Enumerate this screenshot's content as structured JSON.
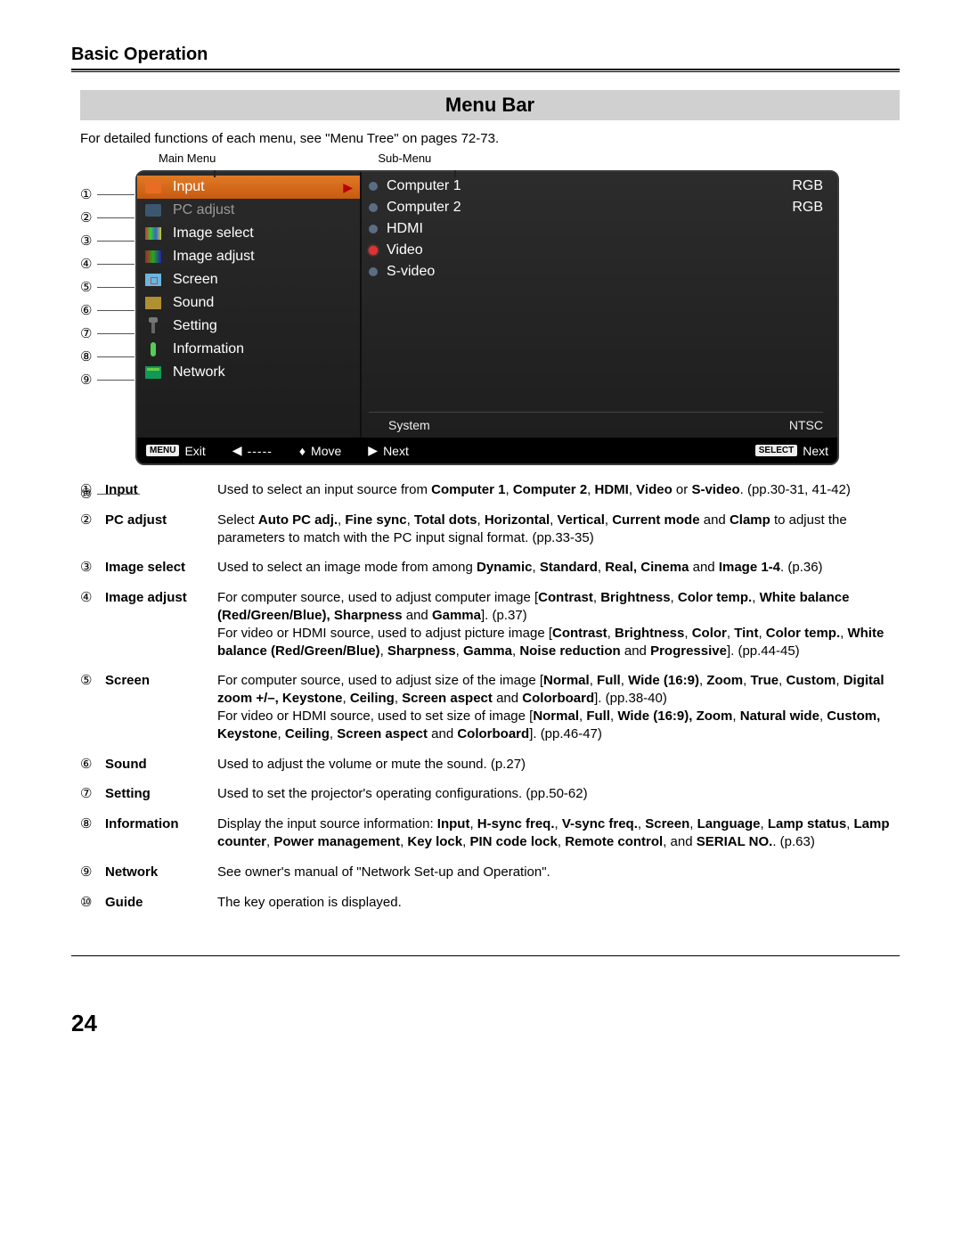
{
  "page": {
    "section_title": "Basic Operation",
    "heading": "Menu Bar",
    "intro": "For detailed functions of each menu, see \"Menu Tree\" on pages 72-73.",
    "label_main": "Main Menu",
    "label_sub": "Sub-Menu",
    "page_number": "24"
  },
  "main_menu": {
    "items": [
      {
        "label": "Input",
        "selected": true
      },
      {
        "label": "PC adjust",
        "dim": true
      },
      {
        "label": "Image select"
      },
      {
        "label": "Image adjust"
      },
      {
        "label": "Screen"
      },
      {
        "label": "Sound"
      },
      {
        "label": "Setting"
      },
      {
        "label": "Information"
      },
      {
        "label": "Network"
      }
    ]
  },
  "sub_menu": {
    "items": [
      {
        "label": "Computer 1",
        "right": "RGB"
      },
      {
        "label": "Computer 2",
        "right": "RGB"
      },
      {
        "label": "HDMI"
      },
      {
        "label": "Video",
        "selected": true
      },
      {
        "label": "S-video"
      }
    ],
    "system_label": "System",
    "system_value": "NTSC"
  },
  "guide_bar": {
    "menu_btn": "MENU",
    "exit": "Exit",
    "back": "-----",
    "move": "Move",
    "next1": "Next",
    "select_btn": "SELECT",
    "next2": "Next"
  },
  "callout_nums": [
    "①",
    "②",
    "③",
    "④",
    "⑤",
    "⑥",
    "⑦",
    "⑧",
    "⑨",
    "⑩"
  ],
  "descriptions": [
    {
      "num": "①",
      "term": "Input",
      "body": "Used to select an input source from <b>Computer 1</b>, <b>Computer 2</b>, <b>HDMI</b>, <b>Video</b> or <b>S-video</b>.  (pp.30-31, 41-42)"
    },
    {
      "num": "②",
      "term": "PC adjust",
      "body": "Select <b>Auto PC adj.</b>, <b>Fine sync</b>, <b>Total dots</b>, <b>Horizontal</b>, <b>Vertical</b>, <b>Current mode</b> and <b>Clamp</b> to adjust the parameters to match with the PC input signal format.  (pp.33-35)"
    },
    {
      "num": "③",
      "term": "Image select",
      "body": "Used to select an image mode from among <b>Dynamic</b>, <b>Standard</b>, <b>Real, Cinema</b> and <b>Image 1-4</b>.  (p.36)"
    },
    {
      "num": "④",
      "term": "Image adjust",
      "body": "For computer source, used to adjust computer image [<b>Contrast</b>, <b>Brightness</b>, <b>Color temp.</b>, <b>White balance (Red/Green/Blue), Sharpness</b> and <b>Gamma</b>].  (p.37)<br>For video or HDMI source, used to adjust picture image [<b>Contrast</b>, <b>Brightness</b>, <b>Color</b>, <b>Tint</b>, <b>Color temp.</b>, <b>White balance (Red/Green/Blue)</b>, <b>Sharpness</b>, <b>Gamma</b>, <b>Noise reduction</b> and <b>Progressive</b>].  (pp.44-45)"
    },
    {
      "num": "⑤",
      "term": "Screen",
      "body": "For computer source, used to adjust size of the image [<b>Normal</b>, <b>Full</b>, <b>Wide (16:9)</b>, <b>Zoom</b>, <b>True</b>, <b>Custom</b>, <b>Digital zoom +/–, Keystone</b>, <b>Ceiling</b>, <b>Screen aspect</b> and <b>Colorboard</b>]. (pp.38-40)<br>For video or HDMI source, used to set size  of image [<b>Normal</b>, <b>Full</b>, <b>Wide (16:9), Zoom</b>, <b>Natural wide</b>, <b>Custom, Keystone</b>, <b>Ceiling</b>, <b>Screen aspect</b> and <b>Colorboard</b>]. (pp.46-47)"
    },
    {
      "num": "⑥",
      "term": "Sound",
      "body": "Used to adjust the volume or mute the sound.  (p.27)"
    },
    {
      "num": "⑦",
      "term": "Setting",
      "body": "Used to set the projector's operating configurations.  (pp.50-62)"
    },
    {
      "num": "⑧",
      "term": "Information",
      "body": "Display the input source information: <b>Input</b>, <b>H-sync freq.</b>, <b>V-sync freq.</b>, <b>Screen</b>, <b>Language</b>, <b>Lamp status</b>, <b>Lamp counter</b>, <b>Power management</b>, <b>Key lock</b>, <b>PIN code lock</b>, <b>Remote control</b>, and <b>SERIAL NO.</b>.  (p.63)"
    },
    {
      "num": "⑨",
      "term": "Network",
      "body": "See owner's manual of \"Network Set-up and Operation\"."
    },
    {
      "num": "⑩",
      "term": "Guide",
      "body": "The key operation is displayed."
    }
  ]
}
